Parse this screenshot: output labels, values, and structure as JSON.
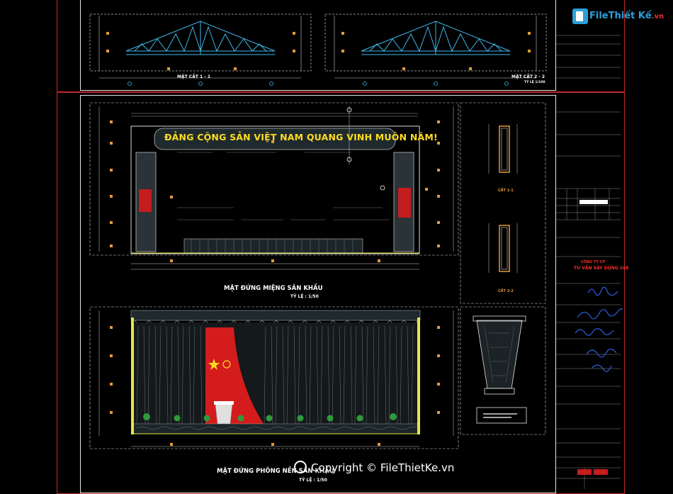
{
  "logo": {
    "brand": "FileThiết Kế",
    "ext": ".vn"
  },
  "section_top": {
    "view_left_title": "MẶT CẮT 1 - 1",
    "view_right_title": "MẶT CẮT 2 - 2",
    "scale": "TỶ LỆ 1/100"
  },
  "stage_front": {
    "slogan": "ĐẢNG CỘNG SẢN VIỆT NAM QUANG VINH MUÔN NĂM!",
    "title": "MẶT ĐỨNG MIỆNG SÂN KHẤU",
    "scale": "TỶ LỆ : 1/50"
  },
  "stage_back": {
    "title": "MẶT ĐỨNG PHÔNG NỀN SÂN KHẤU",
    "scale": "TỶ LỆ : 1/50"
  },
  "details": {
    "cut_a": "CẮT 1-1",
    "cut_b": "CẮT 2-2"
  },
  "title_block": {
    "company_line1": "CÔNG TY CP",
    "company_line2": "TƯ VẤN XÂY DỰNG 168"
  },
  "watermark": "Copyright © FileThietKe.vn",
  "colors": {
    "frame_red": "#c0282b",
    "frame_white": "#e6e6e6",
    "truss_blue": "#3fb8e8",
    "slogan_yellow": "#ffdc1f",
    "flag_red": "#d41c1c",
    "signature_blue": "#2e5fe0"
  }
}
